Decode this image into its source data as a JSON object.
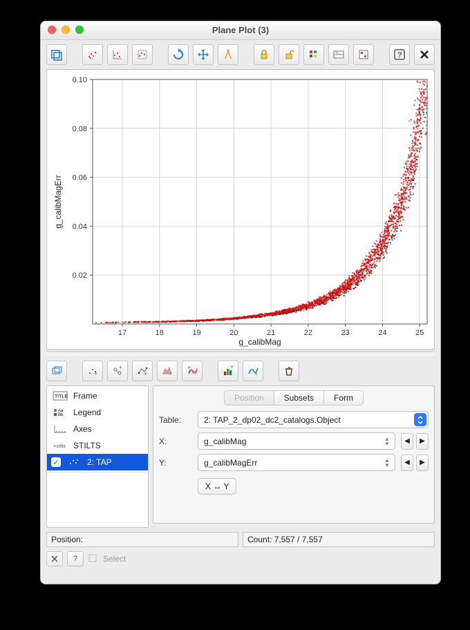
{
  "window": {
    "title": "Plane Plot (3)"
  },
  "tree": {
    "items": [
      {
        "label": "Frame"
      },
      {
        "label": "Legend"
      },
      {
        "label": "Axes"
      },
      {
        "label": "STILTS"
      }
    ],
    "selected_layer": "2: TAP"
  },
  "tabs": {
    "position": "Position",
    "subsets": "Subsets",
    "form": "Form"
  },
  "form": {
    "table_label": "Table:",
    "table_value": "2: TAP_2_dp02_dc2_catalogs.Object",
    "x_label": "X:",
    "x_value": "g_calibMag",
    "y_label": "Y:",
    "y_value": "g_calibMagErr",
    "swap_label": "X ↔ Y"
  },
  "status": {
    "position_label": "Position:",
    "count_label": "Count: 7,557 / 7,557"
  },
  "footer": {
    "select_label": "Select"
  },
  "chart_data": {
    "type": "scatter",
    "title": "",
    "xlabel": "g_calibMag",
    "ylabel": "g_calibMagErr",
    "xlim": [
      16.2,
      25.2
    ],
    "ylim": [
      0,
      0.1
    ],
    "xticks": [
      17,
      18,
      19,
      20,
      21,
      22,
      23,
      24,
      25
    ],
    "yticks": [
      0.02,
      0.04,
      0.06,
      0.08,
      0.1
    ],
    "grid": true,
    "series": [
      {
        "name": "2: TAP_2_dp02_dc2_catalogs.Object",
        "color": "#cc1212",
        "n_points": 7557,
        "trend_curve": [
          {
            "x": 16.5,
            "y": 0.0006
          },
          {
            "x": 17.0,
            "y": 0.0007
          },
          {
            "x": 17.5,
            "y": 0.0008
          },
          {
            "x": 18.0,
            "y": 0.0009
          },
          {
            "x": 18.5,
            "y": 0.0011
          },
          {
            "x": 19.0,
            "y": 0.0013
          },
          {
            "x": 19.5,
            "y": 0.0017
          },
          {
            "x": 20.0,
            "y": 0.0022
          },
          {
            "x": 20.5,
            "y": 0.003
          },
          {
            "x": 21.0,
            "y": 0.004
          },
          {
            "x": 21.5,
            "y": 0.0055
          },
          {
            "x": 22.0,
            "y": 0.0075
          },
          {
            "x": 22.5,
            "y": 0.0105
          },
          {
            "x": 23.0,
            "y": 0.015
          },
          {
            "x": 23.5,
            "y": 0.0215
          },
          {
            "x": 24.0,
            "y": 0.032
          },
          {
            "x": 24.5,
            "y": 0.049
          },
          {
            "x": 24.8,
            "y": 0.065
          },
          {
            "x": 25.0,
            "y": 0.083
          },
          {
            "x": 25.1,
            "y": 0.098
          }
        ],
        "scatter_sigma_frac": 0.15
      }
    ]
  }
}
